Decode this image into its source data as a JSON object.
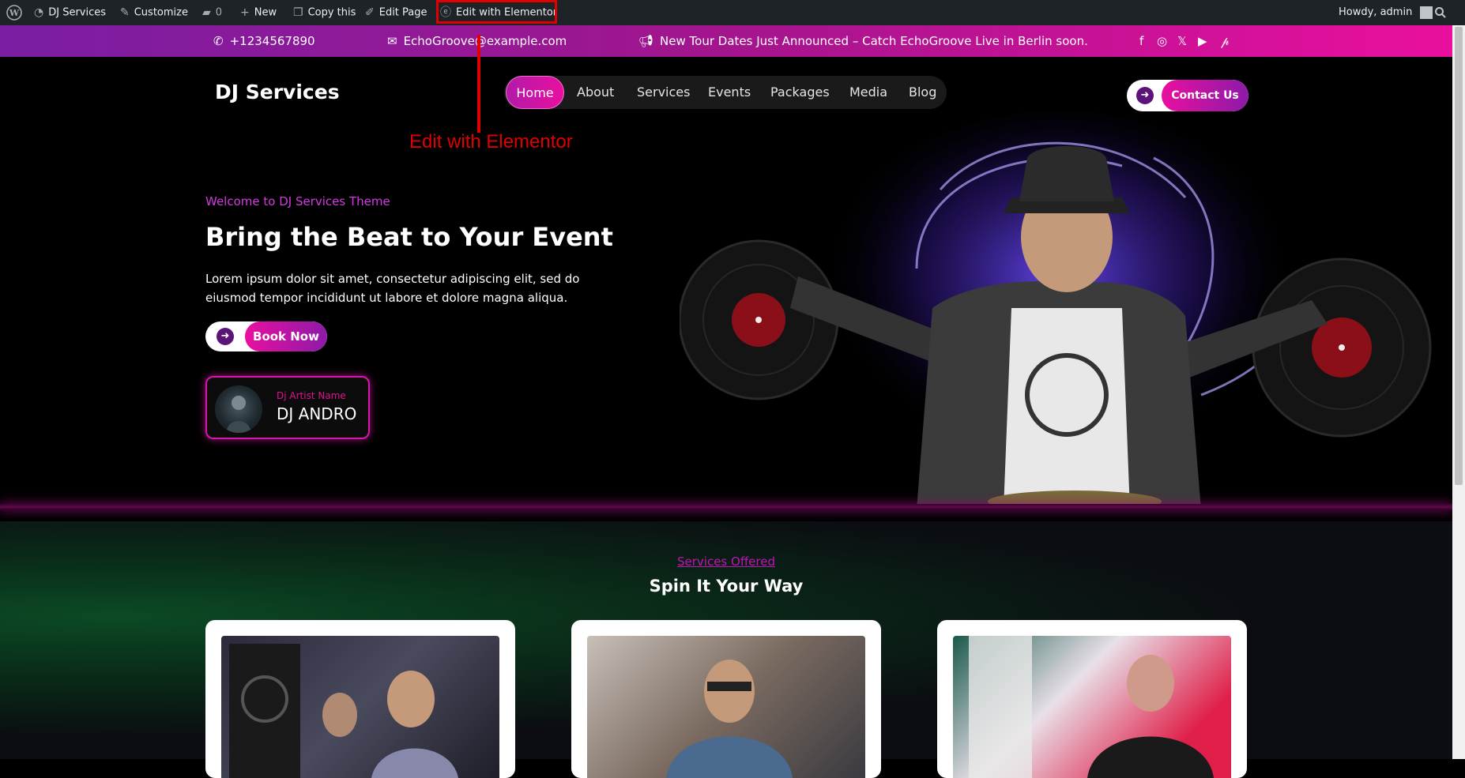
{
  "admin_bar": {
    "site_name": "DJ Services",
    "customize": "Customize",
    "comments_count": "0",
    "new": "New",
    "copy": "Copy this",
    "edit_page": "Edit Page",
    "edit_elementor": "Edit with Elementor",
    "howdy": "Howdy, admin"
  },
  "top_bar": {
    "phone": "+1234567890",
    "email": "EchoGroove@example.com",
    "announcement": "New Tour Dates Just Announced – Catch EchoGroove Live in Berlin soon.",
    "socials": [
      "facebook-icon",
      "instagram-icon",
      "x-icon",
      "youtube-icon",
      "pinterest-icon"
    ]
  },
  "header": {
    "logo": "DJ Services",
    "nav": [
      "Home",
      "About",
      "Services",
      "Events",
      "Packages",
      "Media",
      "Blog"
    ],
    "active_nav": "Home",
    "contact_label": "Contact Us"
  },
  "annotation": {
    "label": "Edit with Elementor",
    "color": "#e00000"
  },
  "hero": {
    "subtitle": "Welcome to DJ Services Theme",
    "title": "Bring the Beat to Your Event",
    "description": "Lorem ipsum dolor sit amet, consectetur adipiscing elit, sed do eiusmod tempor incididunt ut labore et dolore magna aliqua.",
    "cta_label": "Book Now",
    "artist_label": "Dj Artist Name",
    "artist_name": "DJ ANDRO"
  },
  "services": {
    "subtitle": "Services Offered",
    "title": "Spin It Your Way"
  },
  "colors": {
    "accent_pink": "#e90f9f",
    "accent_purple": "#7a1ea3",
    "admin_bar_bg": "#1d2327"
  }
}
